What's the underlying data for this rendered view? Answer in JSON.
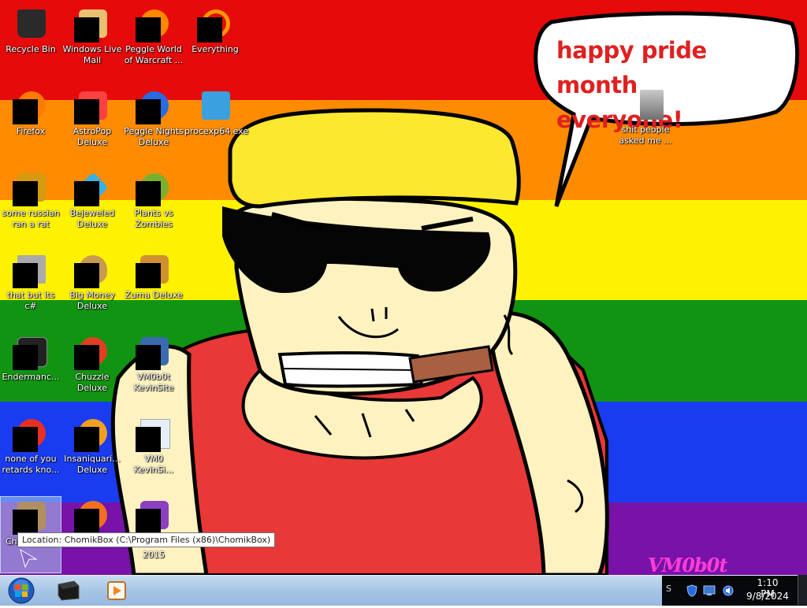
{
  "wallpaper": {
    "speech_bubble": [
      "happy pride month",
      "everyone!"
    ],
    "watermark": "VM0b0t"
  },
  "desktop_icons": [
    {
      "label": "Recycle Bin",
      "icon": "recycle-bin-icon",
      "color": "#2a2a2a",
      "redacted": false
    },
    {
      "label": "Windows Live\nMail",
      "icon": "mail-icon",
      "color": "#e8c070",
      "redacted": true
    },
    {
      "label": "Peggle World\nof Warcraft ...",
      "icon": "peggle-icon",
      "color": "#ff8800",
      "redacted": true
    },
    {
      "label": "Everything",
      "icon": "search-icon",
      "color": "#ff9900",
      "redacted": true
    },
    {
      "label": "Firefox",
      "icon": "firefox-icon",
      "color": "#ff7b00",
      "redacted": true
    },
    {
      "label": "AstroPop\nDeluxe",
      "icon": "game-icon",
      "color": "#ff4040",
      "redacted": true
    },
    {
      "label": "Peggle Nights\nDeluxe",
      "icon": "peggle-icon",
      "color": "#2a6ae0",
      "redacted": true
    },
    {
      "label": "procexp64.exe",
      "icon": "magnifier-icon",
      "color": "#3aa0e0",
      "redacted": false
    },
    {
      "label": "some russian\nran a rat",
      "icon": "game-icon",
      "color": "#d49a10",
      "redacted": true
    },
    {
      "label": "Bejeweled\nDeluxe",
      "icon": "gem-icon",
      "color": "#3ab0e0",
      "redacted": true
    },
    {
      "label": "Plants vs\nZombies",
      "icon": "plant-icon",
      "color": "#7ab030",
      "redacted": true
    },
    {
      "label": "that but its c#",
      "icon": "window-icon",
      "color": "#aaaaaa",
      "redacted": true
    },
    {
      "label": "Big Money\nDeluxe",
      "icon": "money-bag-icon",
      "color": "#c89a50",
      "redacted": true
    },
    {
      "label": "Zuma Deluxe",
      "icon": "zuma-icon",
      "color": "#d09030",
      "redacted": true
    },
    {
      "label": "Endermanc...",
      "icon": "terminal-icon",
      "color": "#222222",
      "redacted": true
    },
    {
      "label": "Chuzzle\nDeluxe",
      "icon": "chuzzle-icon",
      "color": "#e04020",
      "redacted": true
    },
    {
      "label": "VM0b0t\nKevinSite",
      "icon": "site-icon",
      "color": "#3a6ab0",
      "redacted": true
    },
    {
      "label": "none of you\nretards kno...",
      "icon": "browser-icon",
      "color": "#e83020",
      "redacted": true
    },
    {
      "label": "Insaniquari...\nDeluxe",
      "icon": "fish-icon",
      "color": "#f0a020",
      "redacted": true
    },
    {
      "label": "VM0\nKevinSi...",
      "icon": "document-icon",
      "color": "#e8eef8",
      "redacted": true
    },
    {
      "label": "Ch...",
      "icon": "chomikbox-icon",
      "color": "#b09060",
      "redacted": true
    },
    {
      "label": "",
      "icon": "browser-icon",
      "color": "#f07020",
      "redacted": true
    },
    {
      "label": "2015",
      "icon": "visual-studio-icon",
      "color": "#8a40c0",
      "redacted": true
    },
    {
      "label": "shit people\nasked me ...",
      "icon": "folder-icon",
      "color": "#888888",
      "redacted": false
    }
  ],
  "tooltip": "Location: ChomikBox (C:\\Program Files (x86)\\ChomikBox)",
  "taskbar": {
    "start_icon": "windows-start-icon",
    "pinned": [
      "blackbox-icon",
      "media-player-icon"
    ],
    "tray_overflow": "S",
    "clock_time": "1:10 PM",
    "clock_date": "9/8/2024"
  }
}
